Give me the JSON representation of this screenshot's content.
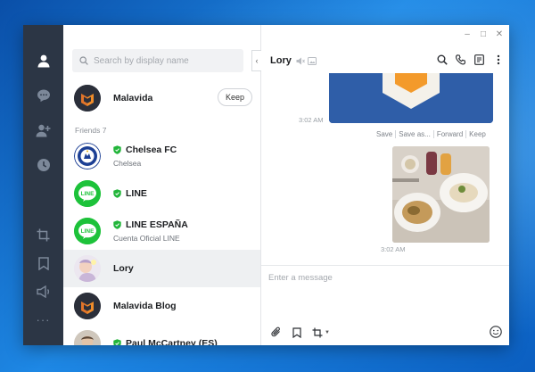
{
  "sidebar": {
    "icons": [
      "person-icon",
      "chat-bubble-icon",
      "add-friend-icon",
      "clock-icon"
    ],
    "bottom_icons": [
      "crop-icon",
      "bookmark-icon",
      "speaker-icon",
      "more-icon"
    ],
    "more_label": "···"
  },
  "friends_panel": {
    "search": {
      "placeholder": "Search by display name",
      "value": ""
    },
    "collapse_label": "‹",
    "me": {
      "name": "Malavida",
      "keep_label": "Keep"
    },
    "section_label": "Friends 7",
    "items": [
      {
        "name": "Chelsea FC",
        "subtitle": "Chelsea",
        "official": true
      },
      {
        "name": "LINE",
        "subtitle": "",
        "official": true
      },
      {
        "name": "LINE ESPAÑA",
        "subtitle": "Cuenta Oficial LINE",
        "official": true
      },
      {
        "name": "Lory",
        "subtitle": "",
        "official": false,
        "selected": true
      },
      {
        "name": "Malavida Blog",
        "subtitle": "",
        "official": false
      },
      {
        "name": "Paul McCartney (ES)",
        "subtitle": "",
        "official": true
      }
    ]
  },
  "window_controls": {
    "minimize": "–",
    "maximize": "□",
    "close": "✕"
  },
  "chat": {
    "title": "Lory",
    "header_actions": [
      "search-icon",
      "phone-icon",
      "notes-icon",
      "more-vertical-icon"
    ],
    "messages": [
      {
        "type": "image",
        "time": "3:02 AM",
        "actions": [
          "Save",
          "Save as...",
          "Forward",
          "Keep"
        ]
      },
      {
        "type": "image",
        "time": "3:02 AM"
      }
    ],
    "composer": {
      "placeholder": "Enter a message",
      "value": ""
    },
    "composer_tools": [
      "paperclip-icon",
      "bookmark-icon",
      "crop-icon",
      "emoji-icon"
    ]
  },
  "colors": {
    "rail_bg": "#2c3645",
    "line_green": "#1dc23a",
    "malavida_orange": "#f08c2a",
    "official_shield": "#22b53a",
    "desktop_blue": "#1e88e5"
  }
}
